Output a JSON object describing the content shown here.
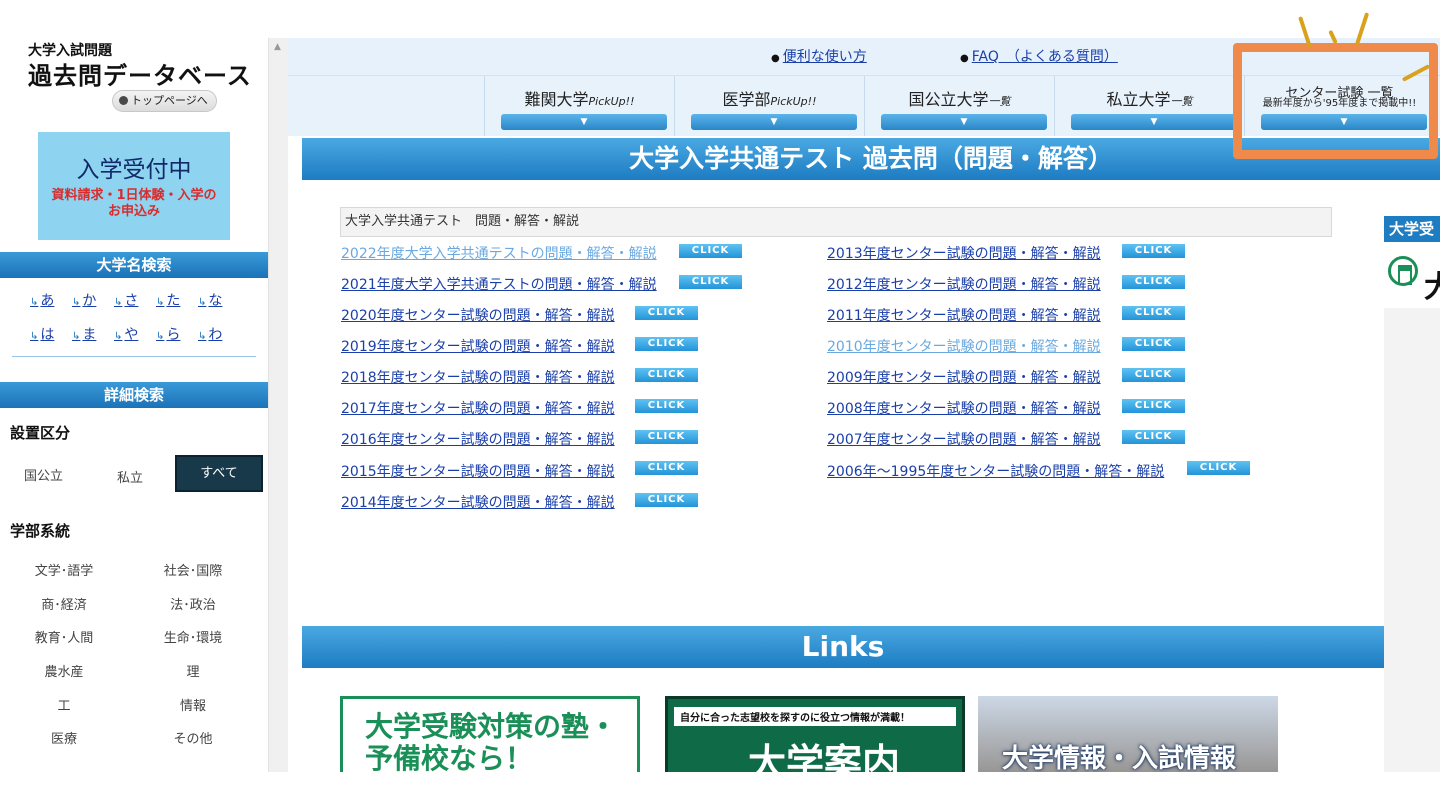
{
  "sidebar": {
    "logo_small": "大学入試問題",
    "logo_big": "過去問データベース",
    "top_link": "トップページへ",
    "banner_title": "入学受付中",
    "banner_sub": "資料請求・1日体験・入学のお申込み",
    "name_search_head": "大学名検索",
    "kana_row1": [
      "あ",
      "か",
      "さ",
      "た",
      "な"
    ],
    "kana_row2": [
      "は",
      "ま",
      "や",
      "ら",
      "わ"
    ],
    "detail_search_head": "詳細検索",
    "type_label": "設置区分",
    "type_public": "国公立",
    "type_private": "私立",
    "type_all": "すべて",
    "faculty_label": "学部系統",
    "faculties": [
      "文学･語学",
      "社会･国際",
      "商･経済",
      "法･政治",
      "教育･人間",
      "生命･環境",
      "農水産",
      "理",
      "工",
      "情報",
      "医療",
      "その他"
    ]
  },
  "top_links": {
    "howto": "便利な使い方",
    "faq": "FAQ　（よくある質問）"
  },
  "nav": {
    "items": [
      {
        "label": "難関大学",
        "suffix": "PickUp!!"
      },
      {
        "label": "医学部",
        "suffix": "PickUp!!"
      },
      {
        "label": "国公立大学",
        "suffix": "一覧"
      },
      {
        "label": "私立大学",
        "suffix": "一覧"
      },
      {
        "label": "センター試験 一覧",
        "suffix": "最新年度から'95年度まで掲載中!!"
      }
    ],
    "arrow": "▼"
  },
  "main": {
    "title": "大学入学共通テスト 過去問（問題・解答）",
    "section_label": "大学入学共通テスト　問題・解答・解説",
    "click_label": "CLICK",
    "left_links": [
      "2022年度大学入学共通テストの問題・解答・解説",
      "2021年度大学入学共通テストの問題・解答・解説",
      "2020年度センター試験の問題・解答・解説",
      "2019年度センター試験の問題・解答・解説",
      "2018年度センター試験の問題・解答・解説",
      "2017年度センター試験の問題・解答・解説",
      "2016年度センター試験の問題・解答・解説",
      "2015年度センター試験の問題・解答・解説",
      "2014年度センター試験の問題・解答・解説"
    ],
    "right_links": [
      "2013年度センター試験の問題・解答・解説",
      "2012年度センター試験の問題・解答・解説",
      "2011年度センター試験の問題・解答・解説",
      "2010年度センター試験の問題・解答・解説",
      "2009年度センター試験の問題・解答・解説",
      "2008年度センター試験の問題・解答・解説",
      "2007年度センター試験の問題・解答・解説",
      "2006年～1995年度センター試験の問題・解答・解説"
    ],
    "links_head": "Links",
    "ads": [
      "大学受験対策の塾・予備校なら！",
      "自分に合った志望校を探すのに役立つ情報が満載！",
      "大学案内",
      "大学情報・入試情報"
    ],
    "right_panel_head": "大学受",
    "right_panel_char": "大"
  },
  "colors": {
    "header_blue": "#1d7cc2",
    "link_blue": "#1a3fa8",
    "highlight_orange": "#f08a4b",
    "click_blue": "#2394d8"
  }
}
